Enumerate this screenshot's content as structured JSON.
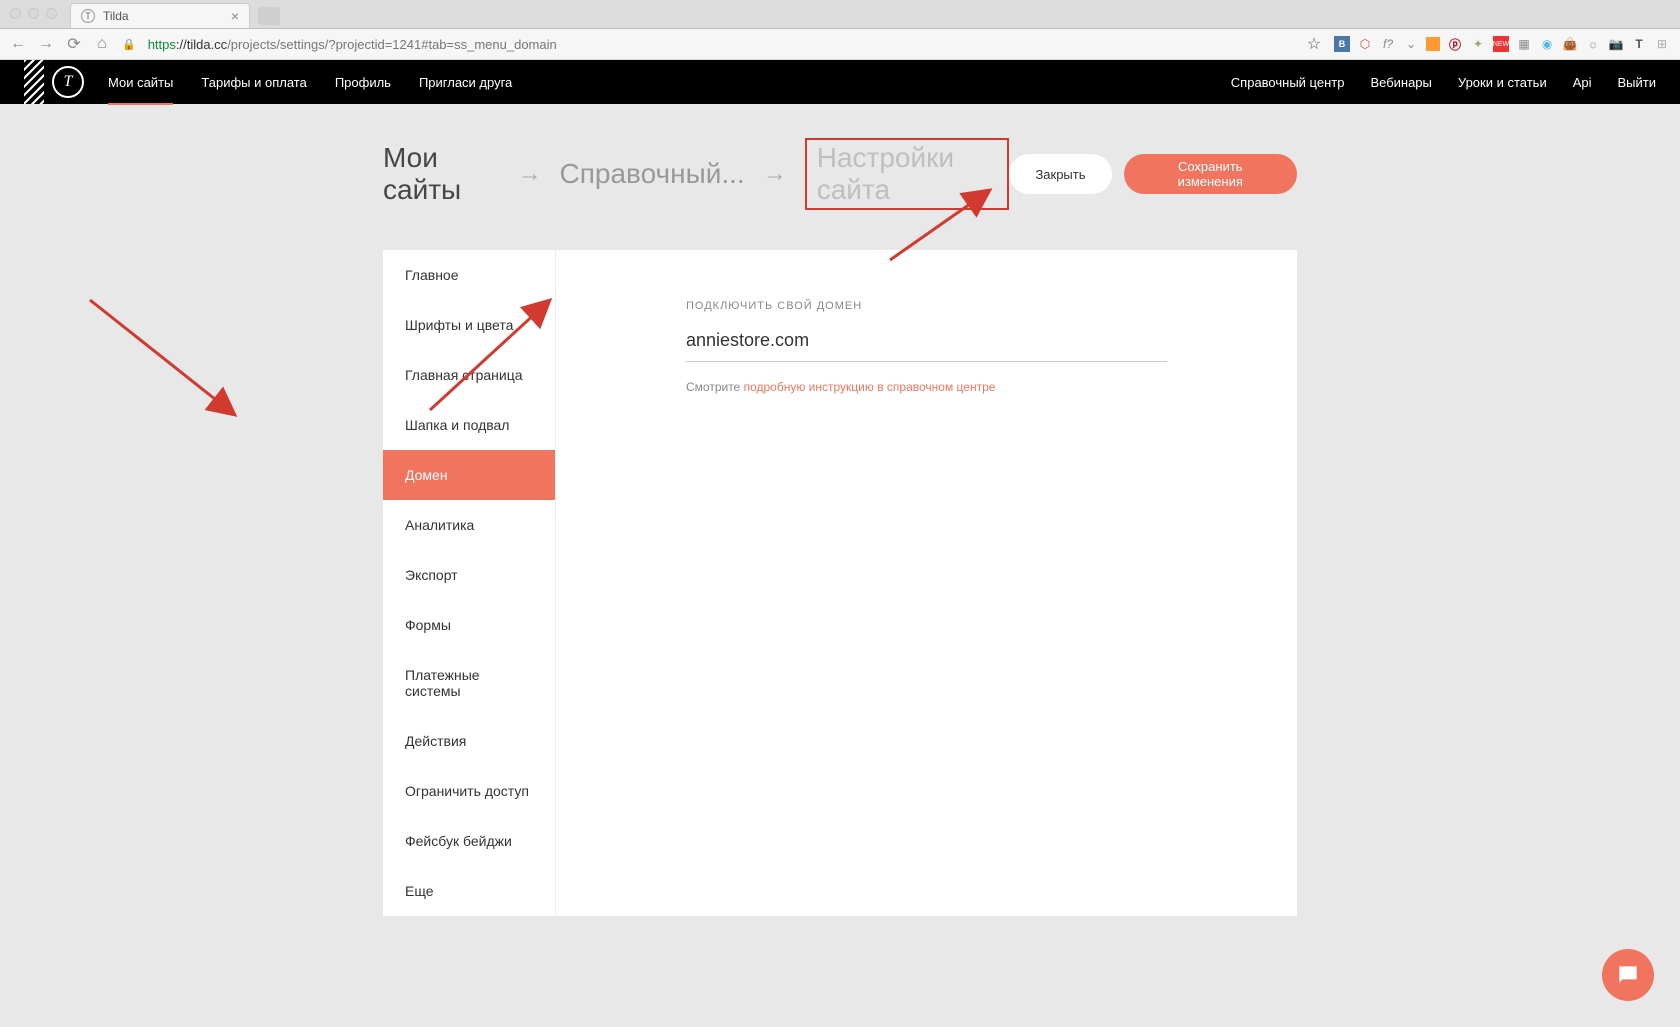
{
  "browser": {
    "tab_title": "Tilda",
    "url_proto": "https",
    "url_host": "://tilda.cc",
    "url_path": "/projects/settings/?projectid=1241#tab=ss_menu_domain"
  },
  "header": {
    "nav": [
      "Мои сайты",
      "Тарифы и оплата",
      "Профиль",
      "Пригласи друга"
    ],
    "nav_right": [
      "Справочный центр",
      "Вебинары",
      "Уроки и статьи",
      "Api",
      "Выйти"
    ]
  },
  "breadcrumb": {
    "items": [
      "Мои сайты",
      "Справочный...",
      "Настройки сайта"
    ]
  },
  "buttons": {
    "close": "Закрыть",
    "save": "Сохранить изменения"
  },
  "sidebar": {
    "items": [
      "Главное",
      "Шрифты и цвета",
      "Главная страница",
      "Шапка и подвал",
      "Домен",
      "Аналитика",
      "Экспорт",
      "Формы",
      "Платежные системы",
      "Действия",
      "Ограничить доступ",
      "Фейсбук бейджи",
      "Еще"
    ],
    "active_index": 4
  },
  "domain": {
    "label": "ПОДКЛЮЧИТЬ СВОЙ ДОМЕН",
    "value": "anniestore.com",
    "hint_prefix": "Смотрите ",
    "hint_link": "подробную инструкцию в справочном центре"
  }
}
